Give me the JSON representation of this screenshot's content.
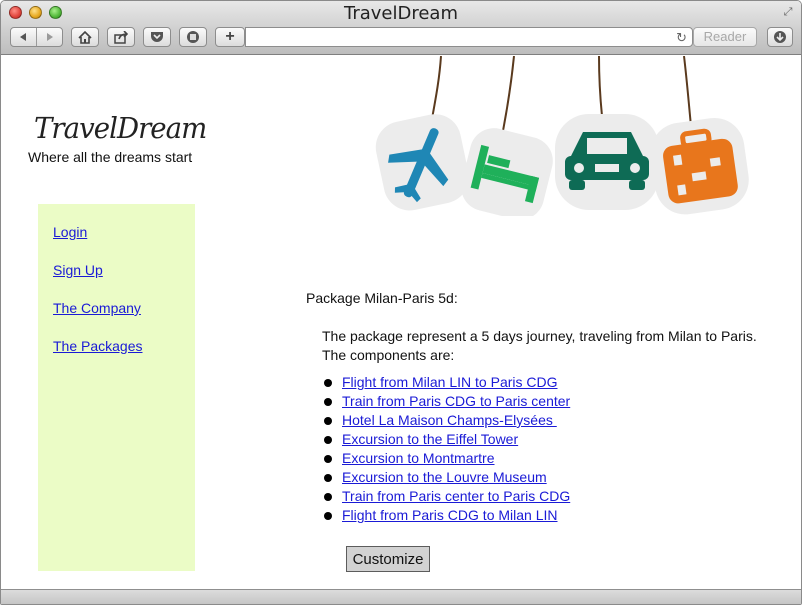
{
  "window": {
    "title": "TravelDream"
  },
  "toolbar": {
    "reader_label": "Reader",
    "address_value": ""
  },
  "brand": {
    "logo": "TravelDream",
    "tagline": "Where all the dreams start"
  },
  "sidebar": {
    "links": [
      {
        "label": "Login"
      },
      {
        "label": "Sign Up"
      },
      {
        "label": "The Company"
      },
      {
        "label": "The Packages"
      }
    ]
  },
  "package": {
    "title": "Package Milan-Paris 5d:",
    "description": "The package represent a 5 days journey, traveling from Milan to Paris. The components are:",
    "components": [
      {
        "label": "Flight from Milan LIN to Paris CDG"
      },
      {
        "label": "Train from Paris CDG to Paris center"
      },
      {
        "label": "Hotel La Maison Champs-Elysées "
      },
      {
        "label": "Excursion to the Eiffel Tower"
      },
      {
        "label": "Excursion to Montmartre"
      },
      {
        "label": "Excursion to the Louvre Museum"
      },
      {
        "label": "Train from Paris center to Paris CDG"
      },
      {
        "label": "Flight from Paris CDG to Milan LIN"
      }
    ],
    "customize_label": "Customize"
  },
  "banner": {
    "tags": [
      {
        "icon": "airplane-icon",
        "color": "#1f87b5"
      },
      {
        "icon": "bed-icon",
        "color": "#1fb05a"
      },
      {
        "icon": "car-icon",
        "color": "#0e6b55"
      },
      {
        "icon": "suitcase-icon",
        "color": "#e8761c"
      }
    ],
    "tag_background": "#ececec",
    "string_color": "#5a3a1e"
  },
  "colors": {
    "sidebar_bg": "#ebfcc6",
    "link": "#1a1ad6"
  }
}
